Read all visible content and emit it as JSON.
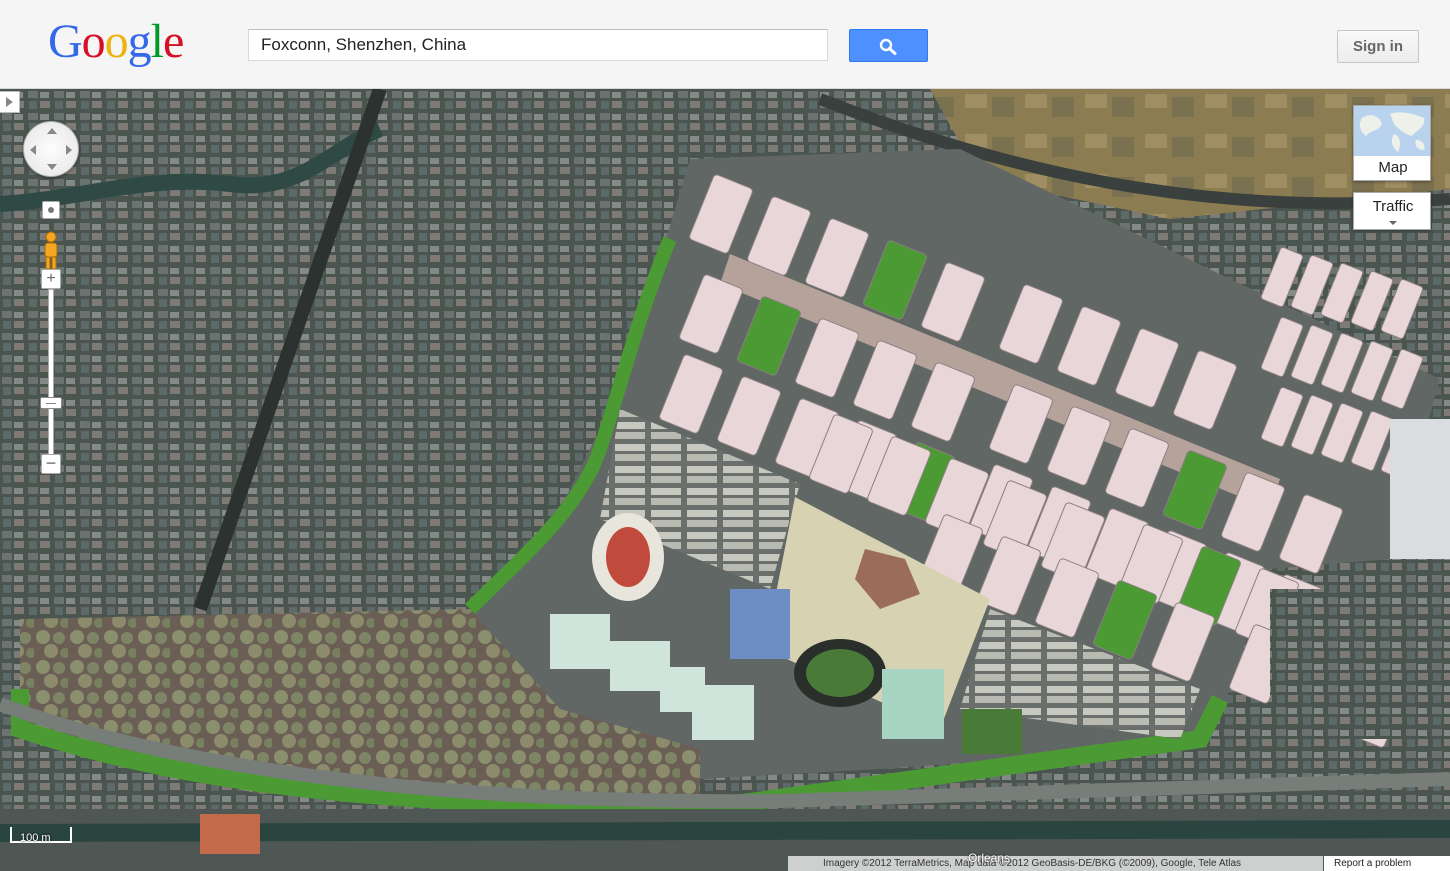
{
  "header": {
    "logo": {
      "letters": [
        "G",
        "o",
        "o",
        "g",
        "l",
        "e"
      ],
      "colors": [
        "#3369e8",
        "#d50f25",
        "#eeb211",
        "#3369e8",
        "#009925",
        "#d50f25"
      ]
    },
    "search_value": "Foxconn, Shenzhen, China",
    "search_icon": "search-icon",
    "sign_in_label": "Sign in"
  },
  "map": {
    "view": "satellite",
    "map_type_label": "Map",
    "traffic_label": "Traffic",
    "zoom_in_label": "+",
    "zoom_out_label": "−",
    "scale_label": "100 m",
    "place_label": "Orleans",
    "attribution": "Imagery ©2012 TerraMetrics, Map data ©2012 GeoBasis-DE/BKG (©2009), Google, Tele Atlas",
    "report_problem_label": "Report a problem",
    "colors": {
      "roof": "#e8d6d8",
      "grass": "#4c9a34",
      "road": "#b5a29a",
      "urban": "#55605c"
    }
  }
}
